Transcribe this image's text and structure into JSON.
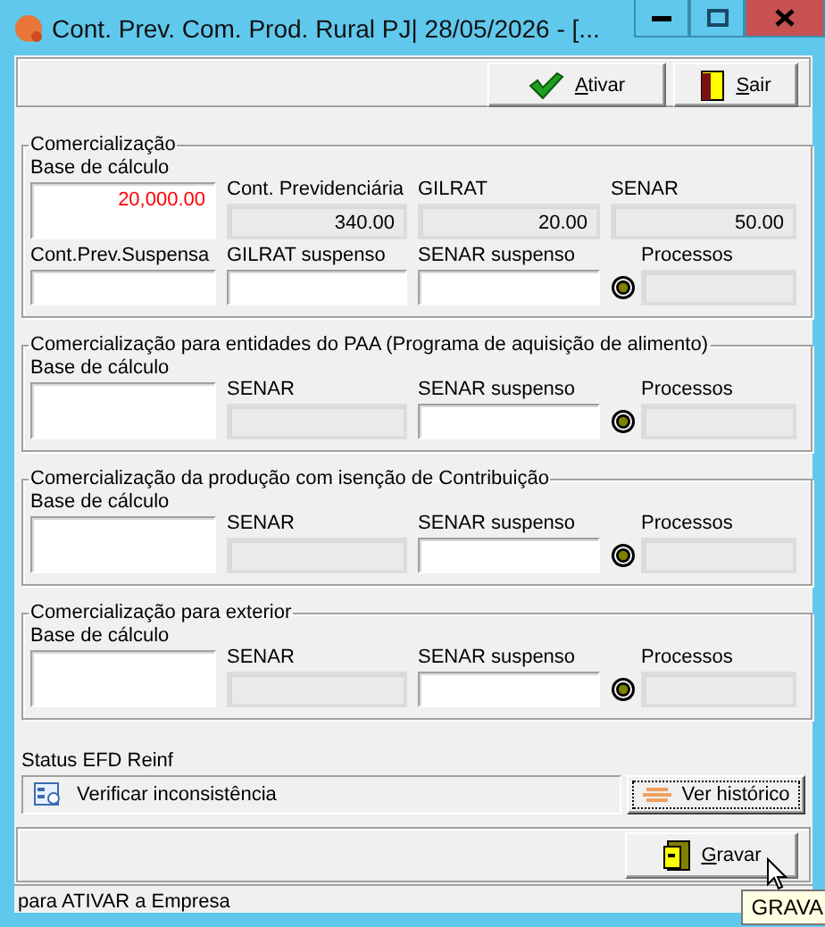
{
  "window": {
    "title": "Cont. Prev. Com. Prod. Rural PJ|  28/05/2026 - [..."
  },
  "toolbar": {
    "buttons": [
      {
        "label": "Ativar",
        "kind": "check"
      },
      {
        "label": "Sair",
        "kind": "exit"
      }
    ]
  },
  "groups": [
    {
      "title": "Comercialização",
      "rows": [
        [
          {
            "kind": "base",
            "label": "Base de cálculo",
            "value": "20,000.00"
          },
          {
            "kind": "readonly",
            "label": "Cont. Previdenciária",
            "value": "340.00"
          },
          {
            "kind": "readonly",
            "label": "GILRAT",
            "value": "20.00"
          },
          {
            "kind": "readonly",
            "label": "SENAR",
            "value": "50.00"
          }
        ],
        [
          {
            "kind": "input",
            "label": "Cont.Prev.Suspensa"
          },
          {
            "kind": "input",
            "label": "GILRAT suspenso"
          },
          {
            "kind": "input",
            "label": "SENAR suspenso"
          },
          {
            "kind": "lookup",
            "label": "Processos"
          }
        ]
      ]
    },
    {
      "title": "Comercialização para entidades do PAA (Programa de aquisição de alimento)",
      "rows": [
        [
          {
            "kind": "base",
            "label": "Base de cálculo"
          },
          {
            "kind": "readonly",
            "label": "SENAR"
          },
          {
            "kind": "input",
            "label": "SENAR suspenso"
          },
          {
            "kind": "lookup",
            "label": "Processos"
          }
        ]
      ]
    },
    {
      "title": "Comercialização da produção com isenção de Contribuição",
      "rows": [
        [
          {
            "kind": "base",
            "label": "Base de cálculo"
          },
          {
            "kind": "readonly",
            "label": "SENAR"
          },
          {
            "kind": "input",
            "label": "SENAR suspenso"
          },
          {
            "kind": "lookup",
            "label": "Processos"
          }
        ]
      ]
    },
    {
      "title": "Comercialização para exterior",
      "rows": [
        [
          {
            "kind": "base",
            "label": "Base de cálculo"
          },
          {
            "kind": "readonly",
            "label": "SENAR"
          },
          {
            "kind": "input",
            "label": "SENAR suspenso"
          },
          {
            "kind": "lookup",
            "label": "Processos"
          }
        ]
      ]
    }
  ],
  "reinf": {
    "label": "Status EFD Reinf",
    "status": "Verificar inconsistência",
    "button": "Ver histórico"
  },
  "save_button": {
    "label": "Gravar"
  },
  "status_bar": "para ATIVAR a Empresa",
  "tooltip": "GRAVA"
}
